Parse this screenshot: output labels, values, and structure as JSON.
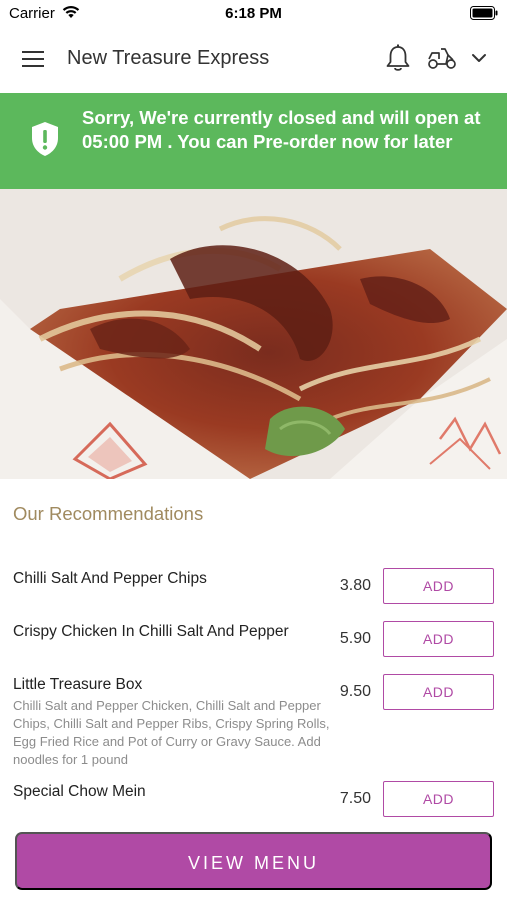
{
  "status_bar": {
    "carrier": "Carrier",
    "time": "6:18 PM"
  },
  "nav": {
    "title": "New Treasure Express",
    "icons": [
      "hamburger-menu-icon",
      "bell-icon",
      "scooter-icon",
      "chevron-down-icon"
    ]
  },
  "banner": {
    "message": "Sorry, We're currently closed and will open at 05:00 PM . You can Pre-order now for later",
    "icon": "shield-alert-icon",
    "color": "#5cb85c"
  },
  "recommendations": {
    "title": "Our Recommendations",
    "items": [
      {
        "name": "Chilli Salt And Pepper Chips",
        "description": "",
        "price": "3.80",
        "add_label": "ADD"
      },
      {
        "name": "Crispy Chicken In Chilli Salt And Pepper",
        "description": "",
        "price": "5.90",
        "add_label": "ADD"
      },
      {
        "name": "Little Treasure Box",
        "description": "Chilli Salt and Pepper Chicken, Chilli Salt and Pepper Chips, Chilli Salt and Pepper Ribs, Crispy Spring Rolls, Egg Fried Rice and Pot of Curry or Gravy Sauce. Add noodles for 1 pound",
        "price": "9.50",
        "add_label": "ADD"
      },
      {
        "name": "Special Chow Mein",
        "description": "",
        "price": "7.50",
        "add_label": "ADD"
      }
    ]
  },
  "footer": {
    "view_menu_label": "VIEW MENU"
  },
  "colors": {
    "accent": "#b04aa5",
    "section_title": "#a08a5f"
  }
}
